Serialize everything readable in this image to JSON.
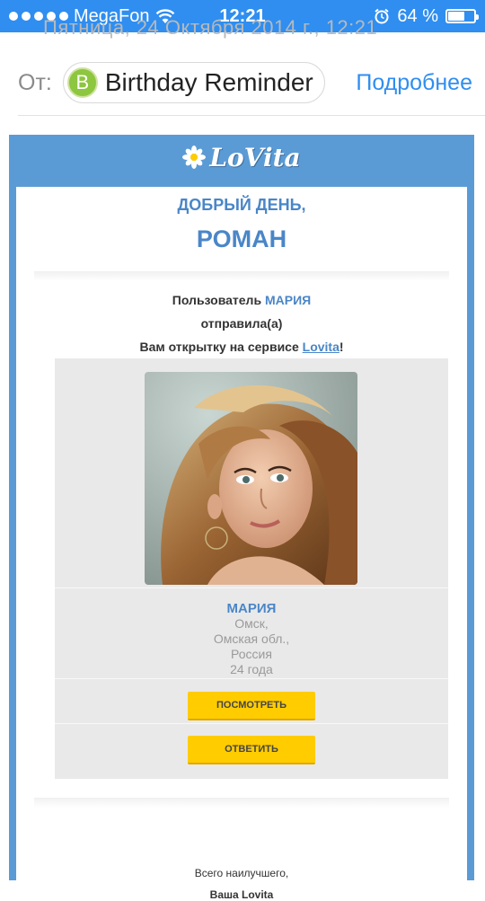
{
  "status_bar": {
    "carrier": "MegaFon",
    "time": "12:21",
    "battery": "64 %",
    "battery_level": 0.64
  },
  "email": {
    "date_line": "Пятница, 24 Октября 2014 г., 12:21",
    "from_label": "От:",
    "sender_initial": "B",
    "sender_name": "Birthday Reminder",
    "more_label": "Подробнее"
  },
  "colors": {
    "ios_blue": "#2f8ef0",
    "frame_blue": "#5b9bd5",
    "accent_blue": "#4a86c8",
    "button_yellow": "#ffcc00",
    "avatar_green": "#8dc63f"
  },
  "mail": {
    "logo": "LoVita",
    "greeting_line1": "ДОБРЫЙ ДЕНЬ,",
    "greeting_name": "РОМАН",
    "msg_user_prefix": "Пользователь",
    "msg_user_name": "МАРИЯ",
    "msg_line2": "отправила(а)",
    "msg_line3_prefix": "Вам открытку на сервисе",
    "msg_service_link": "Lovita",
    "msg_line3_suffix": "!",
    "card": {
      "name": "МАРИЯ",
      "city": "Омск,",
      "region": "Омская обл.,",
      "country": "Россия",
      "age": "24 года",
      "view_button": "ПОСМОТРЕТЬ",
      "reply_button": "ОТВЕТИТЬ"
    },
    "signoff_line1": "Всего наилучшего,",
    "signoff_line2": "Ваша Lovita"
  }
}
